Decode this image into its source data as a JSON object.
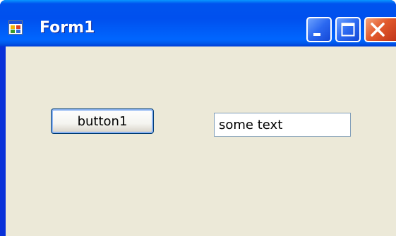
{
  "window": {
    "title": "Form1",
    "icon": "form-app-icon",
    "controls": [
      "minimize-icon",
      "maximize-icon",
      "close-icon"
    ],
    "colors": {
      "titlebar": "#0053ee",
      "client": "#ece9d8",
      "close_button": "#e25a2c"
    }
  },
  "form": {
    "button1_label": "button1",
    "textbox1_value": "some text"
  }
}
